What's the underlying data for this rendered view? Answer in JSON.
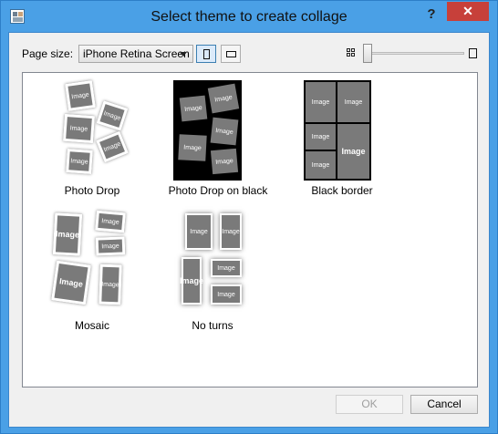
{
  "window": {
    "title": "Select theme to create collage",
    "help_label": "?",
    "close_label": "✕"
  },
  "toolbar": {
    "page_size_label": "Page size:",
    "page_size_value": "iPhone Retina Screen",
    "orientation_selected": "portrait",
    "thumbnail_zoom_level": 0
  },
  "themes": [
    {
      "label": "Photo Drop"
    },
    {
      "label": "Photo Drop on black"
    },
    {
      "label": "Black border"
    },
    {
      "label": "Mosaic"
    },
    {
      "label": "No turns"
    }
  ],
  "placeholder_text": "Image",
  "buttons": {
    "ok_label": "OK",
    "ok_enabled": false,
    "cancel_label": "Cancel"
  },
  "colors": {
    "title_bar": "#4aa0e6",
    "close_button": "#c7403a",
    "placeholder": "#7a7a7a"
  }
}
